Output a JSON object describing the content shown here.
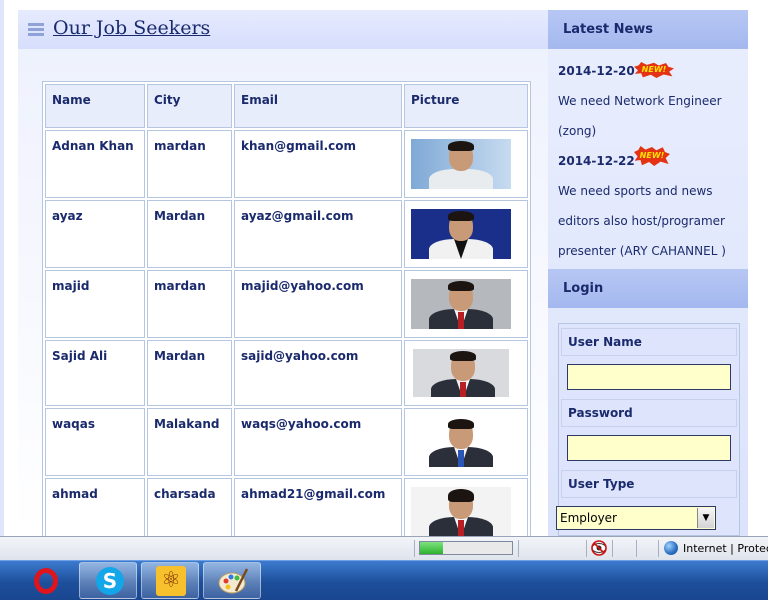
{
  "main": {
    "title": "Our Job Seekers",
    "table": {
      "headers": [
        "Name",
        "City",
        "Email",
        "Picture"
      ],
      "rows": [
        {
          "name": "Adnan Khan",
          "city": "mardan",
          "email": "khan@gmail.com"
        },
        {
          "name": "ayaz",
          "city": "Mardan",
          "email": "ayaz@gmail.com"
        },
        {
          "name": "majid",
          "city": "mardan",
          "email": "majid@yahoo.com"
        },
        {
          "name": "Sajid Ali",
          "city": "Mardan",
          "email": "sajid@yahoo.com"
        },
        {
          "name": "waqas",
          "city": "Malakand",
          "email": "waqs@yahoo.com"
        },
        {
          "name": "ahmad",
          "city": "charsada",
          "email": "ahmad21@gmail.com"
        }
      ]
    }
  },
  "sidebar": {
    "news_title": "Latest News",
    "news": [
      {
        "date": "2014-12-20",
        "badge": "NEW!",
        "text": "We need Network Engineer (zong)"
      },
      {
        "date": "2014-12-22",
        "badge": "NEW!",
        "text": "We need sports and news editors also host/programer presenter (ARY CAHANNEL )"
      }
    ],
    "login": {
      "title": "Login",
      "username_label": "User Name",
      "username_value": "",
      "password_label": "Password",
      "password_value": "",
      "usertype_label": "User Type",
      "usertype_value": "Employer"
    }
  },
  "statusbar": {
    "progress": 0.25,
    "zone_text": "Internet | Protec"
  },
  "taskbar": {
    "apps": [
      "opera-icon",
      "skype-icon",
      "atom-icon",
      "paint-icon"
    ]
  },
  "colors": {
    "accent": "#1a2a6c",
    "header": "#b7c7f4",
    "input_bg": "#ffffcc"
  }
}
